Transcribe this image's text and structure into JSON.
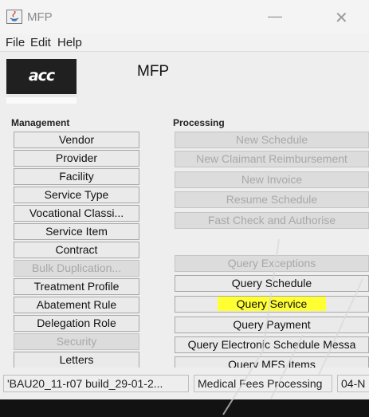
{
  "window": {
    "title": "MFP",
    "minimize_glyph": "—",
    "close_glyph": "✕"
  },
  "menu": [
    {
      "label": "File"
    },
    {
      "label": "Edit"
    },
    {
      "label": "Help"
    }
  ],
  "header": {
    "logo_text": "acc",
    "app_name": "MFP"
  },
  "management": {
    "heading": "Management",
    "items": [
      {
        "label": "Vendor",
        "enabled": true
      },
      {
        "label": "Provider",
        "enabled": true
      },
      {
        "label": "Facility",
        "enabled": true
      },
      {
        "label": "Service Type",
        "enabled": true
      },
      {
        "label": "Vocational Classi...",
        "enabled": true
      },
      {
        "label": "Service Item",
        "enabled": true
      },
      {
        "label": "Contract",
        "enabled": true
      },
      {
        "label": "Bulk Duplication...",
        "enabled": false
      },
      {
        "label": "Treatment Profile",
        "enabled": true
      },
      {
        "label": "Abatement Rule",
        "enabled": true
      },
      {
        "label": "Delegation Role",
        "enabled": true
      },
      {
        "label": "Security",
        "enabled": false
      },
      {
        "label": "Letters",
        "enabled": true
      }
    ]
  },
  "processing": {
    "heading": "Processing",
    "items": [
      {
        "label": "New Schedule",
        "enabled": false
      },
      {
        "label": "New Claimant Reimbursement",
        "enabled": false
      },
      {
        "label": "New Invoice",
        "enabled": false
      },
      {
        "label": "Resume Schedule",
        "enabled": false
      },
      {
        "label": "Fast Check and Authorise",
        "enabled": false
      }
    ],
    "query_items": [
      {
        "label": "Query Exceptions",
        "enabled": false
      },
      {
        "label": "Query Schedule",
        "enabled": true
      },
      {
        "label": "Query Service",
        "enabled": true,
        "highlighted": true
      },
      {
        "label": "Query Payment",
        "enabled": true
      },
      {
        "label": "Query Electronic Schedule Messa",
        "enabled": true
      },
      {
        "label": "Query MFS Items",
        "enabled": true
      }
    ]
  },
  "status": {
    "build": "'BAU20_11-r07 build_29-01-2...",
    "module": "Medical Fees Processing",
    "date": "04-N"
  },
  "colors": {
    "highlight": "#ffff33",
    "disabled_text": "#a8a8a8",
    "background": "#eeeeee"
  }
}
